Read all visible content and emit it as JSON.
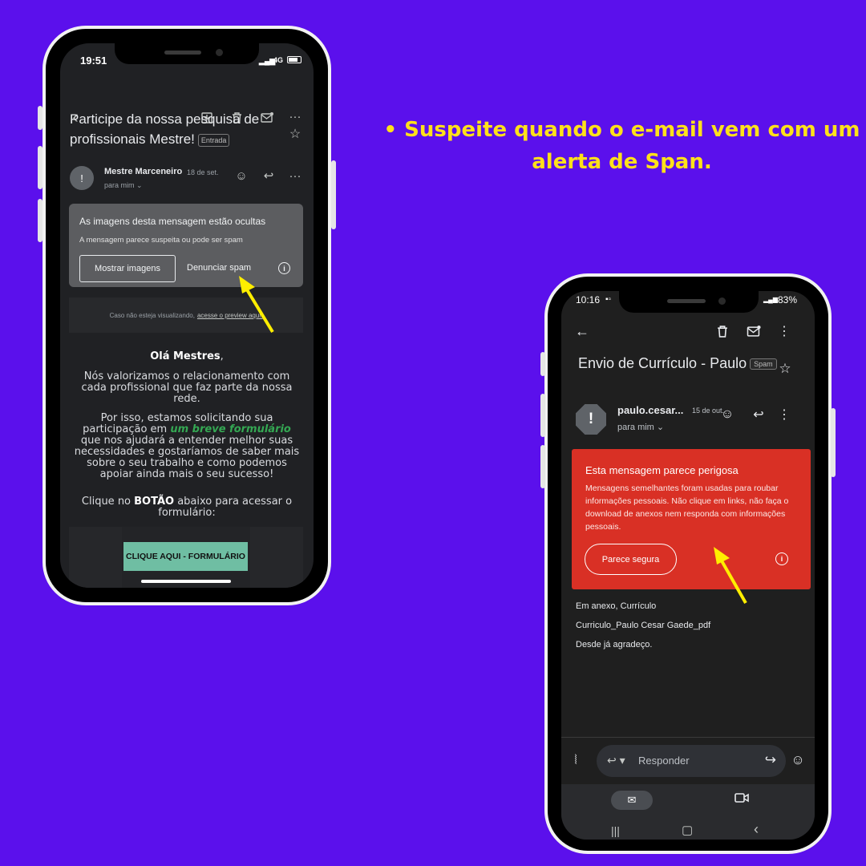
{
  "caption": {
    "line1": "• Suspeite quando o e-mail vem com um",
    "line2": "alerta de Span."
  },
  "phone1": {
    "status": {
      "time": "19:51",
      "network": "4G"
    },
    "subject": "Participe da nossa pesquisa de profissionais Mestre!",
    "label": "Entrada",
    "sender": "Mestre Marceneiro",
    "date": "18 de set.",
    "to": "para mim",
    "warning": {
      "title": "As imagens desta mensagem estão ocultas",
      "subtitle": "A mensagem parece suspeita ou pode ser spam",
      "show_button": "Mostrar imagens",
      "report_button": "Denunciar spam"
    },
    "preview_text": "Caso não esteja visualizando,",
    "preview_link": "acesse o preview aqui.",
    "greeting": "Olá Mestres",
    "greeting_comma": ",",
    "para1": "Nós valorizamos o relacionamento com cada profissional que faz parte da nossa rede.",
    "para2_pre": "Por isso, estamos solicitando sua participação em ",
    "para2_link": "um breve formulário",
    "para2_post": " que nos ajudará a entender melhor suas necessidades e gostaríamos de saber mais sobre o seu trabalho e como podemos apoiar ainda mais o seu sucesso!",
    "para3_pre": "Clique no ",
    "para3_bold": "BOTÃO",
    "para3_post": " abaixo para acessar o formulário:",
    "form_button": "CLIQUE AQUI - FORMULÁRIO"
  },
  "phone2": {
    "status": {
      "time": "10:16",
      "battery": "83%"
    },
    "subject": "Envio de Currículo - Paulo",
    "label": "Spam",
    "sender": "paulo.cesar...",
    "date": "15 de out.",
    "to": "para mim",
    "danger": {
      "title": "Esta mensagem parece perigosa",
      "description": "Mensagens semelhantes foram usadas para roubar informações pessoais. Não clique em links, não faça o download de anexos nem responda com informações pessoais.",
      "safe_button": "Parece segura"
    },
    "body_lines": [
      "Em anexo, Currículo",
      "Curriculo_Paulo Cesar Gaede_pdf",
      "Desde já agradeço."
    ],
    "reply_placeholder": "Responder"
  },
  "colors": {
    "background": "#5b10ec",
    "caption": "#ffe11a",
    "danger": "#d93025",
    "arrow": "#ffee00"
  }
}
